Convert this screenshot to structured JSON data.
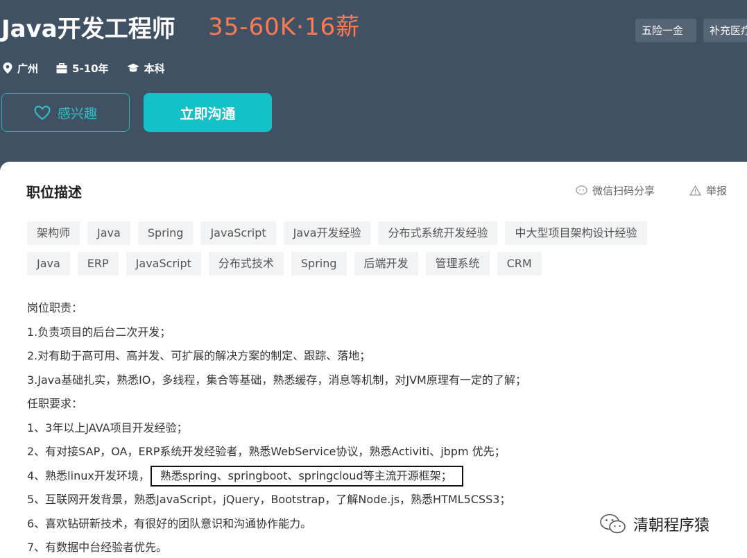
{
  "header": {
    "title": "Java开发工程师",
    "salary": "35-60K·16薪",
    "benefits": [
      "五险一金",
      "补充医疗"
    ],
    "meta": {
      "location": "广州",
      "experience": "5-10年",
      "education": "本科"
    },
    "interest_label": "感兴趣",
    "chat_label": "立即沟通"
  },
  "section": {
    "title": "职位描述",
    "share_label": "微信扫码分享",
    "report_label": "举报"
  },
  "tags_row1": [
    "架构师",
    "Java",
    "Spring",
    "JavaScript",
    "Java开发经验",
    "分布式系统开发经验",
    "中大型项目架构设计经验"
  ],
  "tags_row2": [
    "Java",
    "ERP",
    "JavaScript",
    "分布式技术",
    "Spring",
    "后端开发",
    "管理系统",
    "CRM"
  ],
  "description": {
    "l0": "岗位职责：",
    "l1": "1.负责项目的后台二次开发；",
    "l2": "2.对有助于高可用、高并发、可扩展的解决方案的制定、跟踪、落地；",
    "l3": "3.Java基础扎实，熟悉IO，多线程，集合等基础，熟悉缓存，消息等机制，对JVM原理有一定的了解；",
    "l4": "任职要求：",
    "l5": "1、3年以上JAVA项目开发经验；",
    "l6": "2、有对接SAP，OA，ERP系统开发经验者，熟悉WebService协议，熟悉Activiti、jbpm 优先；",
    "l7a": "4、熟悉linux开发环境，",
    "l7b": "熟悉spring、springboot、springcloud等主流开源框架；",
    "l8": "5、互联网开发背景，熟悉JavaScript，jQuery，Bootstrap，了解Node.js，熟悉HTML5CSS3；",
    "l9": "6、喜欢钻研新技术，有很好的团队意识和沟通协作能力。",
    "l10": "7、有数据中台经验者优先。"
  },
  "watermark": "清朝程序猿",
  "colors": {
    "header_bg": "#3f5163",
    "salary": "#ff7a50",
    "accent": "#14c1c6"
  },
  "icons": [
    "location-pin-icon",
    "briefcase-icon",
    "graduation-cap-icon",
    "heart-icon",
    "wechat-icon",
    "warning-icon"
  ]
}
